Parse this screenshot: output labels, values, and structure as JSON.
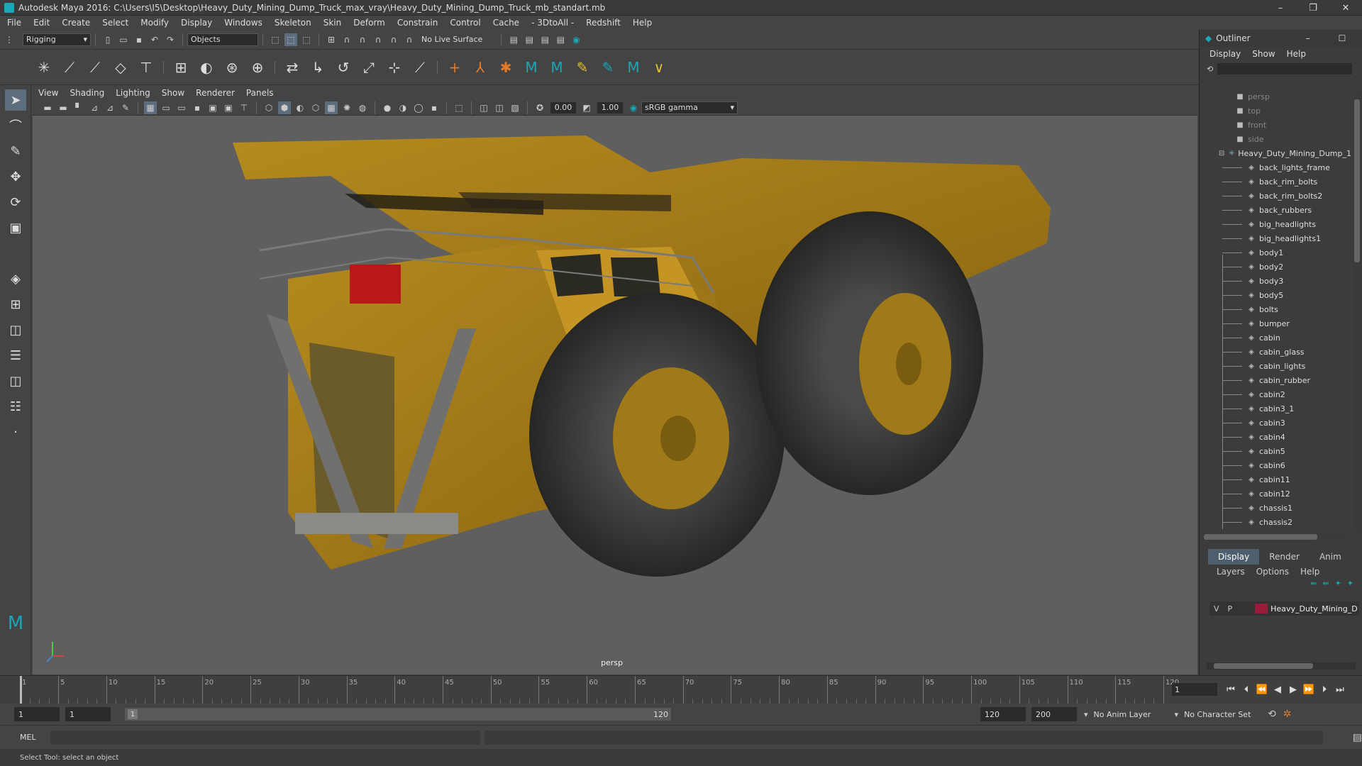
{
  "window": {
    "title": "Autodesk Maya 2016: C:\\Users\\I5\\Desktop\\Heavy_Duty_Mining_Dump_Truck_max_vray\\Heavy_Duty_Mining_Dump_Truck_mb_standart.mb",
    "minimize": "–",
    "maximize": "❐",
    "close": "✕"
  },
  "menu": [
    "File",
    "Edit",
    "Create",
    "Select",
    "Modify",
    "Display",
    "Windows",
    "Skeleton",
    "Skin",
    "Deform",
    "Constrain",
    "Control",
    "Cache",
    "- 3DtoAll -",
    "Redshift",
    "Help"
  ],
  "shelf": {
    "mode": "Rigging",
    "selection_mode": "Objects",
    "live_surface": "No Live Surface"
  },
  "viewport": {
    "menu": [
      "View",
      "Shading",
      "Lighting",
      "Show",
      "Renderer",
      "Panels"
    ],
    "exposure": "0.00",
    "gamma": "1.00",
    "color_space": "sRGB gamma",
    "camera_label": "persp"
  },
  "outliner": {
    "title": "Outliner",
    "menu": [
      "Display",
      "Show",
      "Help"
    ],
    "cameras": [
      "persp",
      "top",
      "front",
      "side"
    ],
    "root": "Heavy_Duty_Mining_Dump_1",
    "children": [
      "back_lights_frame",
      "back_rim_bolts",
      "back_rim_bolts2",
      "back_rubbers",
      "big_headlights",
      "big_headlights1",
      "body1",
      "body2",
      "body3",
      "body5",
      "bolts",
      "bumper",
      "cabin",
      "cabin_glass",
      "cabin_lights",
      "cabin_rubber",
      "cabin2",
      "cabin3_1",
      "cabin3",
      "cabin4",
      "cabin5",
      "cabin6",
      "cabin11",
      "cabin12",
      "chassis1",
      "chassis2"
    ]
  },
  "layers": {
    "tabs": [
      "Display",
      "Render",
      "Anim"
    ],
    "menu": [
      "Layers",
      "Options",
      "Help"
    ],
    "row": {
      "v": "V",
      "p": "P",
      "name": "Heavy_Duty_Mining_D",
      "color": "#9b1c3a"
    }
  },
  "timeline": {
    "ticks": [
      1,
      5,
      10,
      15,
      20,
      25,
      30,
      35,
      40,
      45,
      50,
      55,
      60,
      65,
      70,
      75,
      80,
      85,
      90,
      95,
      100,
      105,
      110,
      115,
      120
    ],
    "current_frame": "1"
  },
  "range": {
    "start": "1",
    "playback_start": "1",
    "slider_start": "1",
    "slider_end": "120",
    "playback_end": "120",
    "end": "200",
    "anim_layer": "No Anim Layer",
    "character_set": "No Character Set"
  },
  "cmdline": {
    "label": "MEL"
  },
  "status": {
    "message": "Select Tool: select an object"
  },
  "colors": {
    "accent": "#4d5e6e",
    "truck": "#b8860b",
    "layer": "#9b1c3a"
  }
}
